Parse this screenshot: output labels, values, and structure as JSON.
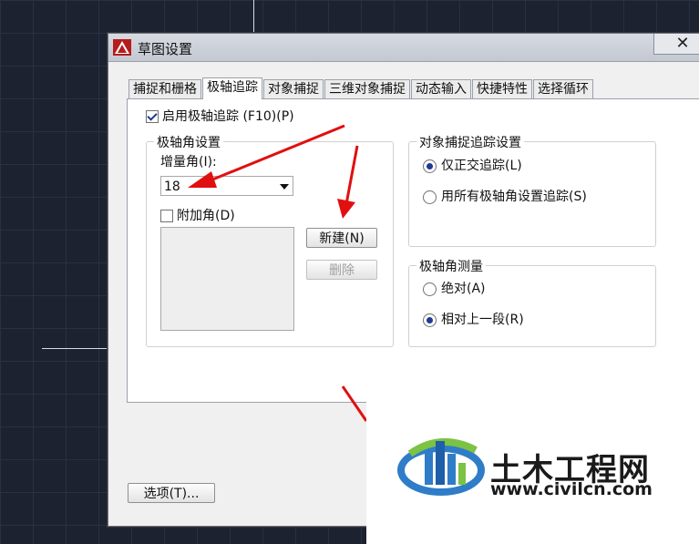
{
  "dialog": {
    "title": "草图设置",
    "close_label": "✕"
  },
  "tabs": [
    {
      "label": "捕捉和栅格"
    },
    {
      "label": "极轴追踪"
    },
    {
      "label": "对象捕捉"
    },
    {
      "label": "三维对象捕捉"
    },
    {
      "label": "动态输入"
    },
    {
      "label": "快捷特性"
    },
    {
      "label": "选择循环"
    }
  ],
  "polar": {
    "enable_label": "启用极轴追踪 (F10)(P)",
    "enable_checked": true,
    "angle_group_title": "极轴角设置",
    "increment_label": "增量角(I):",
    "increment_value": "18",
    "additional_label": "附加角(D)",
    "additional_checked": false,
    "new_button": "新建(N)",
    "delete_button": "删除"
  },
  "object_snap_tracking": {
    "title": "对象捕捉追踪设置",
    "option1": "仅正交追踪(L)",
    "option2": "用所有极轴角设置追踪(S)",
    "selected": "option1"
  },
  "polar_measure": {
    "title": "极轴角测量",
    "option1": "绝对(A)",
    "option2": "相对上一段(R)",
    "selected": "option2"
  },
  "options_button": "选项(T)...",
  "watermark": {
    "name": "土木工程网",
    "url": "www.civilcn.com"
  },
  "colors": {
    "accent_red": "#e01010",
    "canvas_bg": "#1d2230",
    "radio_blue": "#1f3a93"
  }
}
